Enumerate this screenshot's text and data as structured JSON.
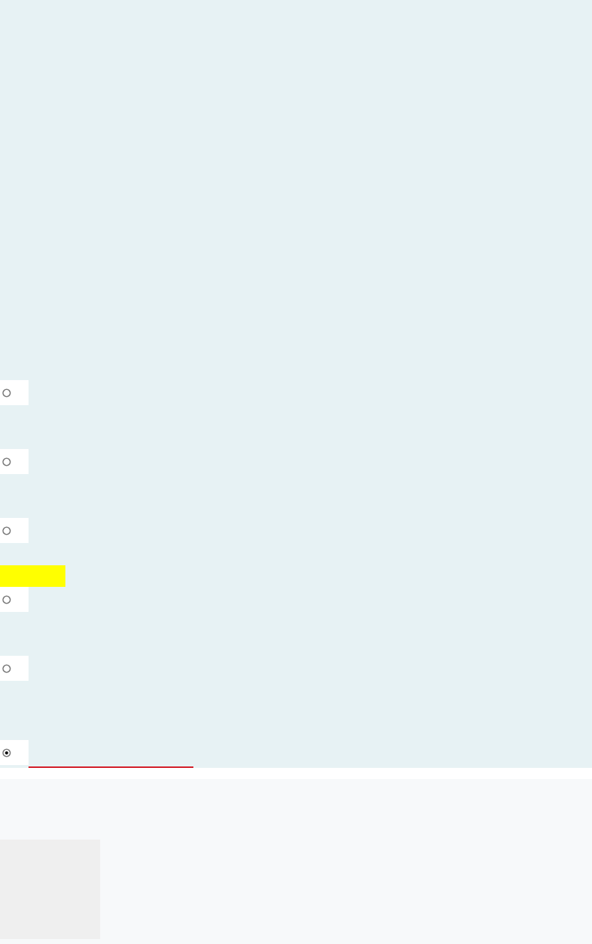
{
  "options": [
    {
      "selected": false,
      "highlighted": false,
      "underlined": false
    },
    {
      "selected": false,
      "highlighted": false,
      "underlined": false
    },
    {
      "selected": false,
      "highlighted": false,
      "underlined": false
    },
    {
      "selected": false,
      "highlighted": true,
      "underlined": false
    },
    {
      "selected": false,
      "highlighted": false,
      "underlined": false
    },
    {
      "selected": true,
      "highlighted": false,
      "underlined": true
    }
  ]
}
